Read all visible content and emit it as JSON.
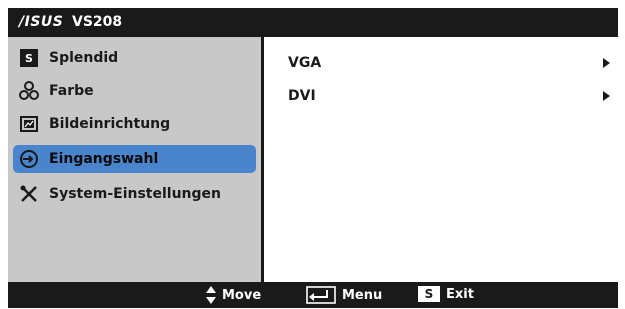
{
  "header": {
    "brand": "/ISUS",
    "model": "VS208"
  },
  "menu": [
    {
      "label": "Splendid",
      "icon": "splendid-s-icon",
      "selected": false
    },
    {
      "label": "Farbe",
      "icon": "color-palette-icon",
      "selected": false
    },
    {
      "label": "Bildeinrichtung",
      "icon": "image-setup-icon",
      "selected": false
    },
    {
      "label": "Eingangswahl",
      "icon": "input-select-icon",
      "selected": true
    },
    {
      "label": "System-Einstellungen",
      "icon": "tools-icon",
      "selected": false
    }
  ],
  "submenu": [
    {
      "label": "VGA"
    },
    {
      "label": "DVI"
    }
  ],
  "footer": {
    "move_label": "Move",
    "menu_label": "Menu",
    "exit_key": "S",
    "exit_label": "Exit"
  },
  "icon_glyphs": {
    "splendid": "S"
  },
  "colors": {
    "selected": "#4a84cc",
    "panel": "#c8c8c8",
    "bar": "#1a1a1a"
  }
}
